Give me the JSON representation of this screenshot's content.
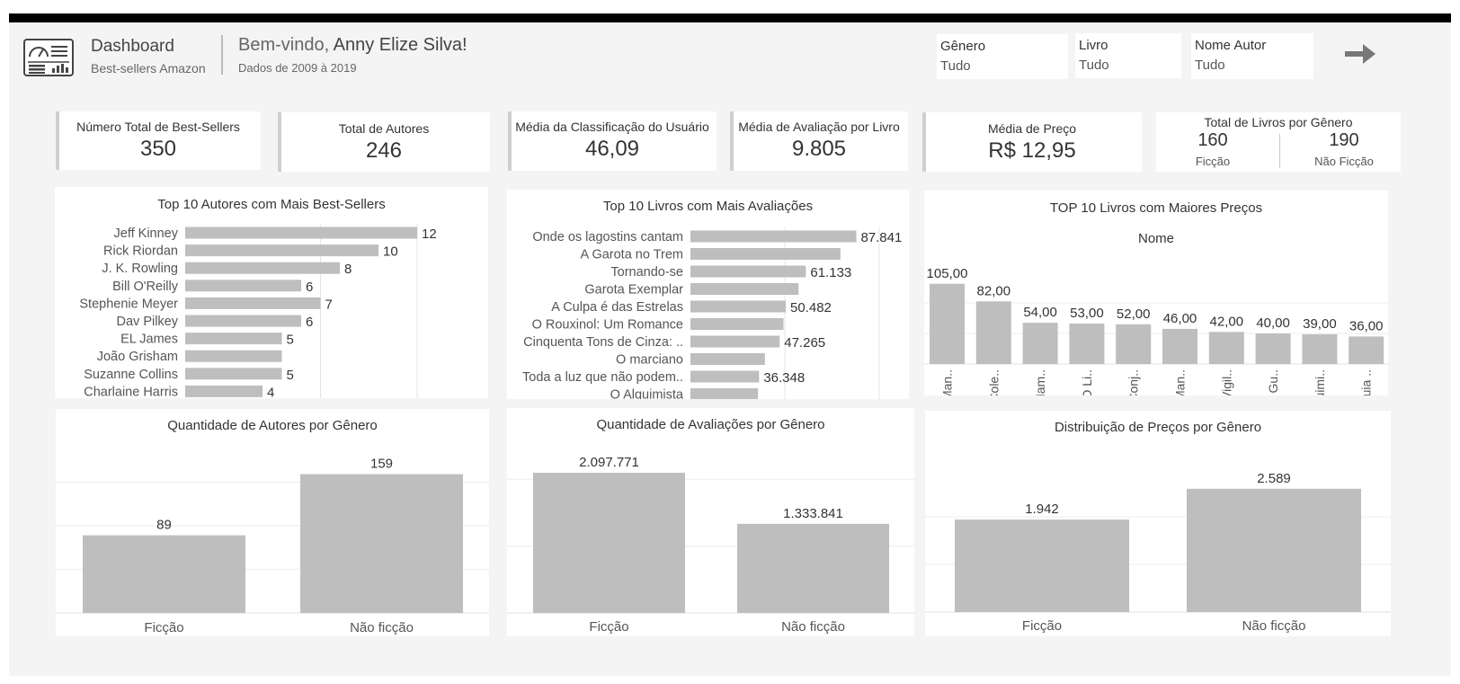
{
  "header": {
    "title": "Dashboard",
    "subtitle": "Best-sellers Amazon",
    "welcome_prefix": "Bem-vindo, ",
    "welcome_name": "Anny Elize Silva!",
    "date_range": "Dados de 2009 à 2019"
  },
  "filters": [
    {
      "label": "Gênero",
      "value": "Tudo"
    },
    {
      "label": "Livro",
      "value": "Tudo"
    },
    {
      "label": "Nome Autor",
      "value": "Tudo"
    }
  ],
  "nav": {
    "next_icon": "arrow-right-icon"
  },
  "kpis": {
    "total_bestsellers": {
      "title": "Número Total de Best-Sellers",
      "value": "350"
    },
    "total_authors": {
      "title": "Total de Autores",
      "value": "246"
    },
    "avg_user_rating": {
      "title": "Média da Classificação do Usuário",
      "value": "46,09"
    },
    "avg_reviews": {
      "title": "Média de Avaliação por Livro",
      "value": "9.805"
    },
    "avg_price": {
      "title": "Média de Preço",
      "value": "R$ 12,95"
    },
    "books_by_genre": {
      "title": "Total de Livros por Gênero",
      "fiction_value": "160",
      "fiction_label": "Ficção",
      "nonfiction_value": "190",
      "nonfiction_label": "Não Ficção"
    }
  },
  "chart_data": [
    {
      "id": "top_authors",
      "type": "bar",
      "orientation": "horizontal",
      "title": "Top 10 Autores com Mais Best-Sellers",
      "categories": [
        "Jeff Kinney",
        "Rick Riordan",
        "J. K. Rowling",
        "Bill O'Reilly",
        "Stephenie Meyer",
        "Dav Pilkey",
        "EL James",
        "João Grisham",
        "Suzanne Collins",
        "Charlaine Harris"
      ],
      "values": [
        12,
        10,
        8,
        6,
        7,
        6,
        5,
        5,
        5,
        4
      ],
      "data_labels": [
        "12",
        "10",
        "8",
        "6",
        "7",
        "6",
        "5",
        "",
        "5",
        "4"
      ],
      "xlim": [
        0,
        14
      ],
      "grid": true,
      "color": "#bebebe"
    },
    {
      "id": "top_reviews",
      "type": "bar",
      "orientation": "horizontal",
      "title": "Top 10 Livros com Mais Avaliações",
      "categories": [
        "Onde os lagostins cantam",
        "A Garota no Trem",
        "Tornando-se",
        "Garota Exemplar",
        "A Culpa é das Estrelas",
        "O Rouxinol: Um Romance",
        "Cinquenta Tons de Cinza: ..",
        "O marciano",
        "Toda a luz que não podem..",
        "O Alquimista"
      ],
      "values": [
        87841,
        79446,
        61133,
        57271,
        50482,
        49288,
        47265,
        39459,
        36348,
        35799
      ],
      "data_labels": [
        "87.841",
        "",
        "61.133",
        "",
        "50.482",
        "",
        "47.265",
        "",
        "36.348",
        ""
      ],
      "xlim": [
        0,
        100000
      ],
      "grid": true,
      "color": "#bebebe"
    },
    {
      "id": "top_prices",
      "type": "bar",
      "title": "TOP 10 Livros com Maiores Preços",
      "subtitle": "Nome",
      "categories": [
        "Man..",
        "Cole..",
        "Ham..",
        "O Li..",
        "Conj..",
        "Man..",
        "Vigil..",
        "O Gu..",
        "O Alq uimi..",
        "Guia .."
      ],
      "values": [
        105,
        82,
        54,
        53,
        52,
        46,
        42,
        40,
        39,
        36
      ],
      "data_labels": [
        "105,00",
        "82,00",
        "54,00",
        "53,00",
        "52,00",
        "46,00",
        "42,00",
        "40,00",
        "39,00",
        "36,00"
      ],
      "ylim": [
        0,
        120
      ],
      "grid": true,
      "color": "#bebebe"
    },
    {
      "id": "authors_by_genre",
      "type": "bar",
      "title": "Quantidade de Autores por Gênero",
      "categories": [
        "Ficção",
        "Não ficção"
      ],
      "values": [
        89,
        159
      ],
      "data_labels": [
        "89",
        "159"
      ],
      "ylim": [
        0,
        175
      ],
      "grid": true,
      "color": "#bebebe"
    },
    {
      "id": "reviews_by_genre",
      "type": "bar",
      "title": "Quantidade de Avaliações por Gênero",
      "categories": [
        "Ficção",
        "Não ficção"
      ],
      "values": [
        2097771,
        1333841
      ],
      "data_labels": [
        "2.097.771",
        "1.333.841"
      ],
      "ylim": [
        0,
        2300000
      ],
      "grid": true,
      "color": "#bebebe"
    },
    {
      "id": "price_by_genre",
      "type": "bar",
      "title": "Distribuição de Preços por Gênero",
      "categories": [
        "Ficção",
        "Não ficção"
      ],
      "values": [
        1942,
        2589
      ],
      "data_labels": [
        "1.942",
        "2.589"
      ],
      "ylim": [
        0,
        3000
      ],
      "grid": true,
      "color": "#bebebe"
    }
  ]
}
